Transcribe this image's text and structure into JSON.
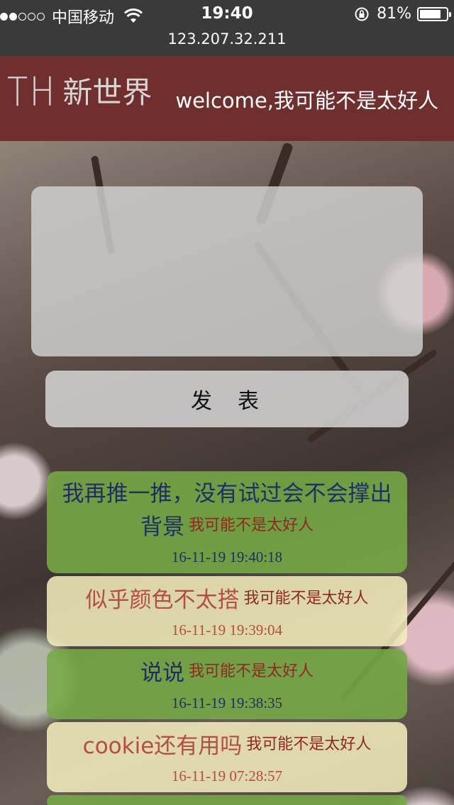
{
  "status_bar": {
    "carrier": "中国移动",
    "time": "19:40",
    "battery_text": "81%",
    "battery_level": 0.81
  },
  "url_bar": {
    "url": "123.207.32.211"
  },
  "header": {
    "logo_letters": "TH",
    "logo_name": "新世界",
    "welcome": "welcome,我可能不是太好人",
    "background_color": "#6e2f2e"
  },
  "composer": {
    "text_value": "",
    "publish_label": "发表"
  },
  "posts": [
    {
      "content": "我再推一推，没有试过会不会撑出背景",
      "author": "我可能不是太好人",
      "time": "16-11-19 19:40:18",
      "color": "green"
    },
    {
      "content": "似乎颜色不太搭",
      "author": "我可能不是太好人",
      "time": "16-11-19 19:39:04",
      "color": "cream"
    },
    {
      "content": "说说",
      "author": "我可能不是太好人",
      "time": "16-11-19 19:38:35",
      "color": "green"
    },
    {
      "content": "cookie还有用吗",
      "author": "我可能不是太好人",
      "time": "16-11-19 07:28:57",
      "color": "cream"
    }
  ],
  "colors": {
    "green_card": "#76aa46",
    "cream_card": "#f5eebe",
    "green_text": "#1f2f63",
    "cream_text": "#b34e42",
    "author_text": "#8c2a20"
  },
  "icons": {
    "wifi": "wifi-icon",
    "rotation_lock": "rotation-lock-icon",
    "battery": "battery-icon"
  }
}
